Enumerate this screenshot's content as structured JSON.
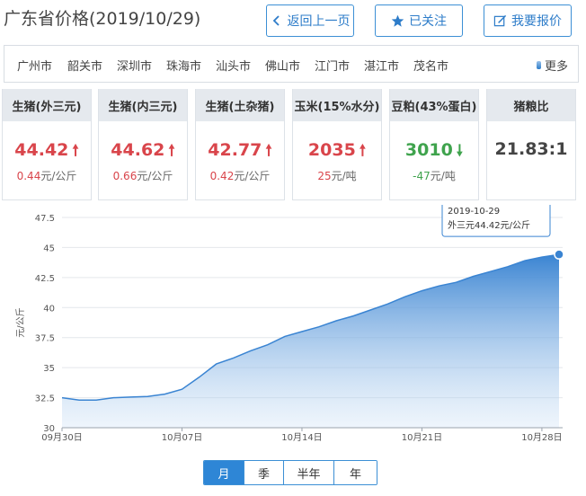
{
  "header": {
    "title": "广东省价格(2019/10/29)",
    "back_label": "返回上一页",
    "follow_label": "已关注",
    "report_label": "我要报价"
  },
  "cities": {
    "items": [
      "广州市",
      "韶关市",
      "深圳市",
      "珠海市",
      "汕头市",
      "佛山市",
      "江门市",
      "湛江市",
      "茂名市"
    ],
    "more_label": "更多"
  },
  "cards": [
    {
      "name": "生猪(外三元)",
      "value": "44.42",
      "trend": "up",
      "change": "0.44",
      "unit": "元/公斤"
    },
    {
      "name": "生猪(内三元)",
      "value": "44.62",
      "trend": "up",
      "change": "0.66",
      "unit": "元/公斤"
    },
    {
      "name": "生猪(土杂猪)",
      "value": "42.77",
      "trend": "up",
      "change": "0.42",
      "unit": "元/公斤"
    },
    {
      "name": "玉米(15%水分)",
      "value": "2035",
      "trend": "up",
      "change": "25",
      "unit": "元/吨"
    },
    {
      "name": "豆粕(43%蛋白)",
      "value": "3010",
      "trend": "down",
      "change": "-47",
      "unit": "元/吨"
    },
    {
      "name": "猪粮比",
      "value": "21.83:1",
      "trend": "none",
      "change": "",
      "unit": ""
    }
  ],
  "colors": {
    "up": "#d9454b",
    "down": "#3fa34d",
    "accent": "#2e86d6"
  },
  "chart_data": {
    "type": "area",
    "ylabel": "元/公斤",
    "ylim": [
      30,
      47.5
    ],
    "yticks": [
      30,
      32.5,
      35,
      37.5,
      40,
      42.5,
      45,
      47.5
    ],
    "x": [
      "2019-09-30",
      "2019-10-01",
      "2019-10-02",
      "2019-10-03",
      "2019-10-04",
      "2019-10-05",
      "2019-10-06",
      "2019-10-07",
      "2019-10-08",
      "2019-10-09",
      "2019-10-10",
      "2019-10-11",
      "2019-10-12",
      "2019-10-13",
      "2019-10-14",
      "2019-10-15",
      "2019-10-16",
      "2019-10-17",
      "2019-10-18",
      "2019-10-19",
      "2019-10-20",
      "2019-10-21",
      "2019-10-22",
      "2019-10-23",
      "2019-10-24",
      "2019-10-25",
      "2019-10-26",
      "2019-10-27",
      "2019-10-28",
      "2019-10-29"
    ],
    "xticks": [
      {
        "x": "2019-09-30",
        "label": "09月30日"
      },
      {
        "x": "2019-10-07",
        "label": "10月07日"
      },
      {
        "x": "2019-10-14",
        "label": "10月14日"
      },
      {
        "x": "2019-10-21",
        "label": "10月21日"
      },
      {
        "x": "2019-10-28",
        "label": "10月28日"
      }
    ],
    "series": [
      {
        "values": [
          32.5,
          32.3,
          32.3,
          32.5,
          32.55,
          32.6,
          32.8,
          33.2,
          34.2,
          35.3,
          35.8,
          36.4,
          36.9,
          37.6,
          38.0,
          38.4,
          38.9,
          39.3,
          39.8,
          40.3,
          40.9,
          41.4,
          41.8,
          42.1,
          42.6,
          43.0,
          43.4,
          43.9,
          44.2,
          44.42
        ]
      }
    ],
    "tooltip": {
      "date": "2019-10-29",
      "text": "外三元44.42元/公斤"
    },
    "grid": true
  },
  "period_tabs": [
    {
      "label": "月",
      "active": true
    },
    {
      "label": "季",
      "active": false
    },
    {
      "label": "半年",
      "active": false
    },
    {
      "label": "年",
      "active": false
    }
  ]
}
